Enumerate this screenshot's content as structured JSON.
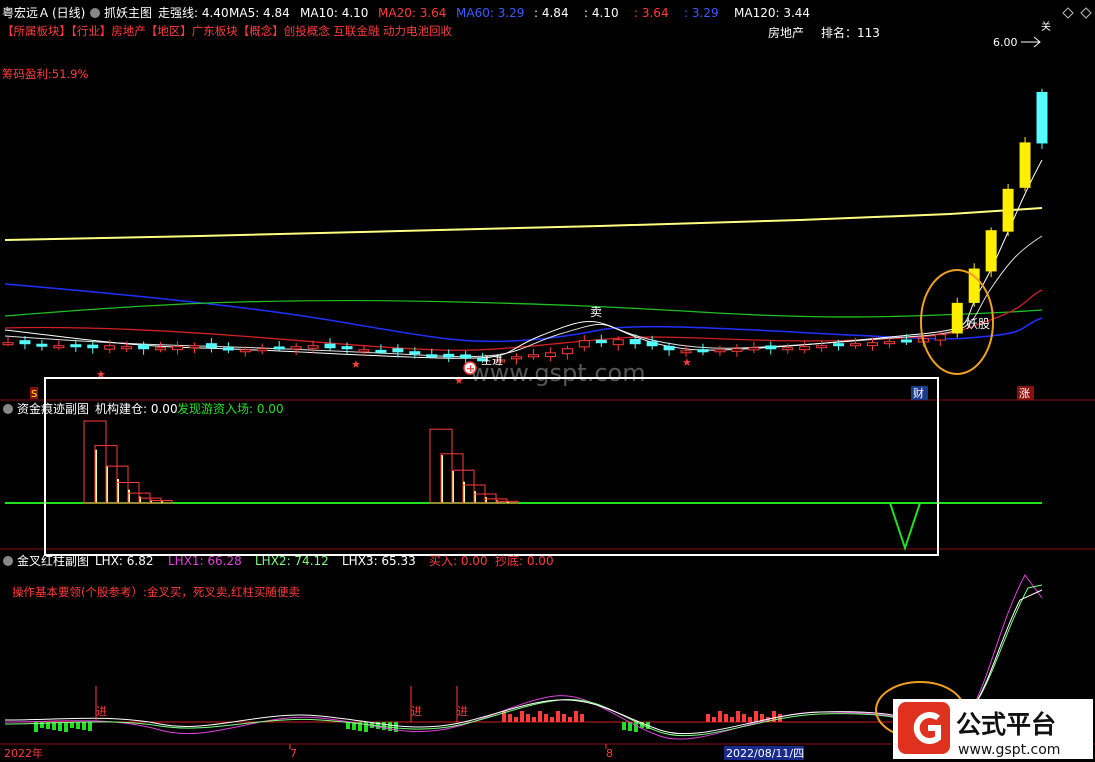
{
  "main_panel": {
    "stock_name": "粤宏远Ａ",
    "period": "(日线)",
    "indicator_name": "抓妖主图",
    "ma_items": [
      {
        "label": "走强线: 4.40",
        "color": "#ffffff"
      },
      {
        "label": "MA5: 4.84",
        "color": "#ffffff"
      },
      {
        "label": "MA10: 4.10",
        "color": "#ffffff"
      },
      {
        "label": "MA20: 3.64",
        "color": "#ff3b3b"
      },
      {
        "label": "MA60: 3.29",
        "color": "#3b5bff"
      },
      {
        "label": ": 4.84",
        "color": "#ffffff"
      },
      {
        "label": ": 4.10",
        "color": "#ffffff"
      },
      {
        "label": ": 3.64",
        "color": "#ff3b3b"
      },
      {
        "label": ": 3.29",
        "color": "#3b5bff"
      },
      {
        "label": "MA120: 3.44",
        "color": "#ffffff"
      }
    ],
    "sector_line": "【所属板块】【行业】房地产【地区】广东板块【概念】创投概念 互联金融 动力电池回收",
    "industry": "房地产",
    "rank_label": "排名：113",
    "chip_profit": "筹码盈利:51.9%",
    "high_label": "6.00",
    "signal_sell": "卖",
    "signal_yao": "妖股",
    "signal_zhuli": "主进",
    "signal_cai": "财",
    "signal_zhang": "涨",
    "signal_s": "S",
    "watermark": "www.gspt.com"
  },
  "sub_panel_1": {
    "title": "资金痕迹副图",
    "item1": "机构建仓: 0.00",
    "item2": "发现游资入场: 0.00"
  },
  "sub_panel_2": {
    "title": "金叉红柱副图",
    "items": [
      {
        "label": "LHX: 6.82",
        "color": "#ffffff"
      },
      {
        "label": "LHX1: 66.28",
        "color": "#e040e0"
      },
      {
        "label": "LHX2: 74.12",
        "color": "#7cff7c"
      },
      {
        "label": "LHX3: 65.33",
        "color": "#ffffff"
      },
      {
        "label": "买入: 0.00",
        "color": "#ff3b3b"
      },
      {
        "label": "抄底: 0.00",
        "color": "#ff3b3b"
      }
    ],
    "note": "操作基本要领(个股参考）:金叉买，死叉卖,红柱买随便卖",
    "jin_label": "进"
  },
  "x_axis": {
    "labels": [
      "2022年",
      "7",
      "8",
      "2022/08/11/四"
    ]
  },
  "logo": {
    "text": "公式平台",
    "url": "www.gspt.com"
  },
  "colors": {
    "up": "#ff3b3b",
    "down": "#54ffff",
    "limit_up": "#ffee00",
    "ma_white": "#ffffff",
    "ma_yellow": "#ffff80",
    "ma_blue": "#2030ff",
    "ma_green": "#20c020",
    "ma_red": "#d02020",
    "highlight": "#f0a020"
  },
  "chart_data": {
    "type": "candlestick",
    "price_high": 6.0,
    "close_series_approx": [
      3.02,
      3.01,
      3.0,
      2.99,
      2.98,
      2.97,
      2.99,
      2.98,
      2.96,
      2.97,
      2.98,
      2.99,
      2.97,
      2.96,
      2.95,
      2.96,
      2.97,
      2.98,
      2.99,
      2.97,
      2.96,
      2.95,
      2.94,
      2.93,
      2.92,
      2.9,
      2.88,
      2.87,
      2.86,
      2.85,
      2.88,
      2.9,
      2.92,
      2.96,
      3.04,
      3.02,
      3.05,
      3.01,
      2.99,
      2.95,
      2.94,
      2.93,
      2.95,
      2.96,
      2.97,
      2.96,
      2.97,
      2.98,
      2.99,
      3.0,
      3.01,
      3.02,
      3.03,
      3.04,
      3.06,
      3.1,
      3.41,
      3.75,
      4.13,
      4.54,
      5.0,
      5.5
    ],
    "fund_trace_bars": [
      {
        "series": "机构建仓",
        "groups": [
          [
            1.0,
            0.7,
            0.45,
            0.25,
            0.12,
            0.06,
            0.03
          ],
          [
            0.9,
            0.6,
            0.4,
            0.22,
            0.11,
            0.05,
            0.02
          ]
        ]
      }
    ]
  }
}
